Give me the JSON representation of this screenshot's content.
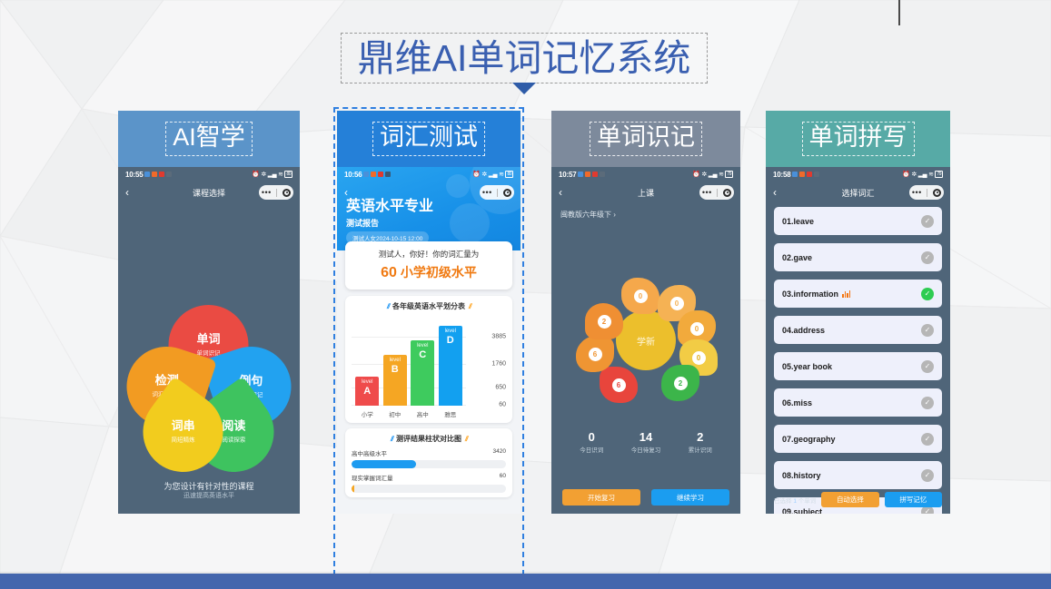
{
  "slide": {
    "title": "鼎维AI单词记忆系统",
    "accent_blue": "#3a5fb0",
    "bottom_bar_color": "#4466ad"
  },
  "cards": [
    {
      "label": "AI智学",
      "header_color": "#5b94c9",
      "phone": {
        "status_time": "10:55",
        "nav_title": "课程选择",
        "back_icon": "chevron-left-icon",
        "petals": [
          {
            "main": "单词",
            "sub": "单词识记",
            "color": "#ea4b43"
          },
          {
            "main": "例句",
            "sub": "例句识记",
            "color": "#22a2f0"
          },
          {
            "main": "检测",
            "sub": "词汇量测试",
            "color": "#f29b22"
          },
          {
            "main": "阅读",
            "sub": "阅读探索",
            "color": "#3ec35f"
          },
          {
            "main": "词串",
            "sub": "简短精炼",
            "color": "#f2cc1e"
          }
        ],
        "tagline_1": "为您设计有针对性的课程",
        "tagline_2": "迅速提高英语水平"
      }
    },
    {
      "label": "词汇测试",
      "header_color": "#2580d8",
      "selected": true,
      "phone": {
        "status_time": "10:56",
        "hero_title": "英语水平专业",
        "hero_sub": "测试报告",
        "hero_pill": "测试人女2024-10-15 12:00",
        "greeting": "测试人，你好！你的词汇量为",
        "score_number": "60",
        "score_level": "小学初级水平",
        "chart_card_title": "各年级英语水平划分表",
        "compare_title": "测评结果柱状对比图",
        "compare_rows": [
          {
            "label": "高中高级水平",
            "value": "3420",
            "percent": 42,
            "color": "#1d9bf0"
          },
          {
            "label": "现实掌握词汇量",
            "value": "60",
            "percent": 2,
            "color": "#f5a623"
          }
        ]
      }
    },
    {
      "label": "单词识记",
      "header_color": "#7d8a9c",
      "phone": {
        "status_time": "10:57",
        "nav_title": "上课",
        "subtitle": "闽教版六年级下 ›",
        "center_label": "学新",
        "petals": [
          {
            "value": "0",
            "color": "#f5a84b",
            "text": "#f5a84b"
          },
          {
            "value": "0",
            "color": "#f5b254",
            "text": "#f5b254"
          },
          {
            "value": "0",
            "color": "#f2aa3c",
            "text": "#f2aa3c"
          },
          {
            "value": "0",
            "color": "#f2cc45",
            "text": "#e0ae1e"
          },
          {
            "value": "2",
            "color": "#3cb54a",
            "text": "#3cb54a"
          },
          {
            "value": "6",
            "color": "#e8453c",
            "text": "#e8453c"
          },
          {
            "value": "6",
            "color": "#ef9533",
            "text": "#ef9533"
          },
          {
            "value": "2",
            "color": "#ef8f33",
            "text": "#ef8f33"
          }
        ],
        "stats": [
          {
            "value": "0",
            "label": "今日识词"
          },
          {
            "value": "14",
            "label": "今日待复习"
          },
          {
            "value": "2",
            "label": "累计识词"
          }
        ],
        "buttons": [
          {
            "label": "开始复习",
            "color": "#f2a033"
          },
          {
            "label": "继续学习",
            "color": "#1b9df0"
          }
        ]
      }
    },
    {
      "label": "单词拼写",
      "header_color": "#57aaa6",
      "phone": {
        "status_time": "10:58",
        "nav_title": "选择词汇",
        "words": [
          {
            "text": "01.leave",
            "checked": false,
            "playing": false
          },
          {
            "text": "02.gave",
            "checked": false,
            "playing": false
          },
          {
            "text": "03.information",
            "checked": true,
            "playing": true
          },
          {
            "text": "04.address",
            "checked": false,
            "playing": false
          },
          {
            "text": "05.year book",
            "checked": false,
            "playing": false
          },
          {
            "text": "06.miss",
            "checked": false,
            "playing": false
          },
          {
            "text": "07.geography",
            "checked": false,
            "playing": false
          },
          {
            "text": "08.history",
            "checked": false,
            "playing": false
          },
          {
            "text": "09.subject",
            "checked": false,
            "playing": false
          }
        ],
        "selected_prefix": "已选择",
        "selected_count": "1",
        "selected_suffix": "个单词",
        "buttons": [
          {
            "label": "自动选择",
            "color": "#f2a033"
          },
          {
            "label": "拼写记忆",
            "color": "#1b9df0"
          }
        ]
      }
    }
  ],
  "chart_data": {
    "type": "bar",
    "title": "各年级英语水平划分表",
    "categories": [
      "小学",
      "初中",
      "高中",
      "雅思"
    ],
    "bar_labels": [
      "level A",
      "level B",
      "level C",
      "level D"
    ],
    "values": [
      60,
      650,
      1760,
      3885
    ],
    "ytick_labels": [
      "3885",
      "1760",
      "650",
      "60"
    ],
    "colors": [
      "#ef4b4b",
      "#f5a623",
      "#3ecb5e",
      "#12a0f0"
    ],
    "xlabel": "",
    "ylabel": "",
    "grid": true,
    "legend": "none"
  }
}
